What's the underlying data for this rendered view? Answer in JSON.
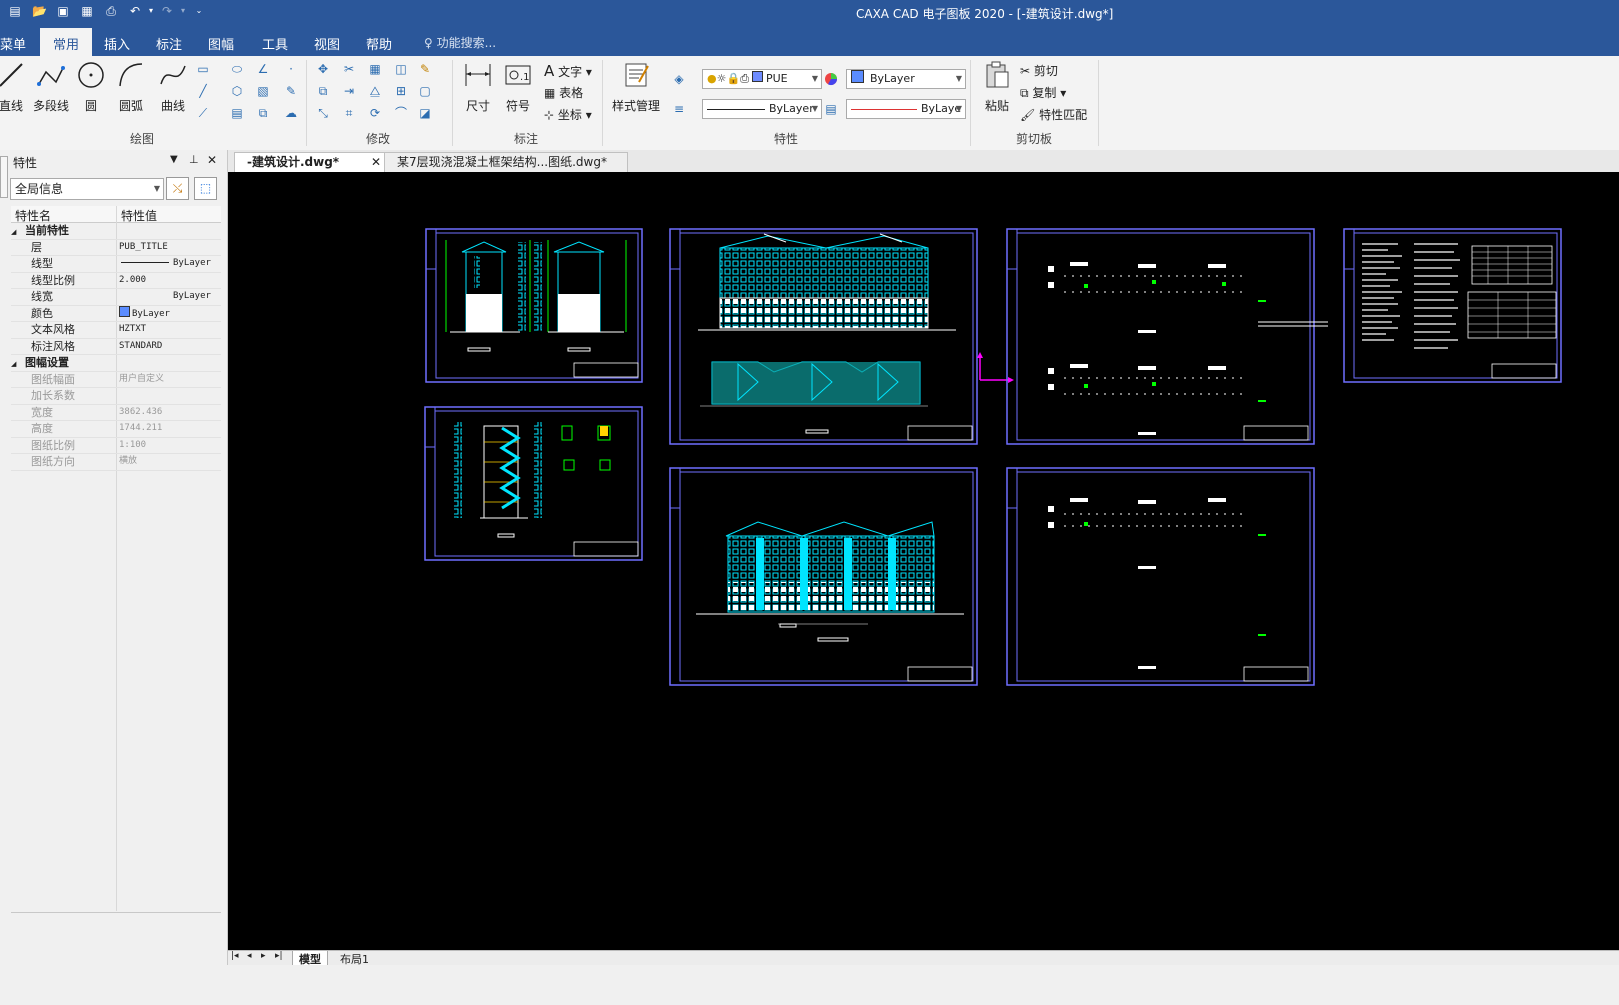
{
  "window": {
    "title": "CAXA CAD 电子图板 2020 - [-建筑设计.dwg*]"
  },
  "ribbon_tabs": [
    "菜单",
    "常用",
    "插入",
    "标注",
    "图幅",
    "工具",
    "视图",
    "帮助"
  ],
  "function_search": "功能搜索...",
  "draw_group": {
    "label": "绘图",
    "buttons": [
      "直线",
      "多段线",
      "圆",
      "圆弧",
      "曲线"
    ]
  },
  "modify_group": {
    "label": "修改"
  },
  "dim_group": {
    "label": "标注",
    "buttons": [
      "尺寸",
      "符号"
    ],
    "small": [
      "文字",
      "表格",
      "坐标"
    ]
  },
  "style_group": {
    "button": "样式管理"
  },
  "prop_group": {
    "label": "特性",
    "layer_value": "PUE",
    "color_value": "ByLayer",
    "linetype_value": "ByLayer",
    "linewidth_value": "ByLaye"
  },
  "clip_group": {
    "label": "剪切板",
    "paste": "粘贴",
    "small": [
      "剪切",
      "复制",
      "特性匹配"
    ]
  },
  "panel": {
    "title": "特性",
    "scope": "全局信息",
    "col_name": "特性名",
    "col_value": "特性值",
    "rows": [
      {
        "k": "当前特性",
        "v": "",
        "type": "group"
      },
      {
        "k": "层",
        "v": "PUB_TITLE",
        "type": "normal"
      },
      {
        "k": "线型",
        "v": "ByLayer",
        "type": "normal"
      },
      {
        "k": "线型比例",
        "v": "2.000",
        "type": "normal"
      },
      {
        "k": "线宽",
        "v": "ByLayer",
        "type": "normal"
      },
      {
        "k": "颜色",
        "v": "ByLayer",
        "type": "normal"
      },
      {
        "k": "文本风格",
        "v": "HZTXT",
        "type": "normal"
      },
      {
        "k": "标注风格",
        "v": "STANDARD",
        "type": "normal"
      },
      {
        "k": "图幅设置",
        "v": "",
        "type": "group"
      },
      {
        "k": "图纸幅面",
        "v": "用户自定义",
        "type": "dim"
      },
      {
        "k": "加长系数",
        "v": "",
        "type": "dim"
      },
      {
        "k": "宽度",
        "v": "3862.436",
        "type": "dim"
      },
      {
        "k": "高度",
        "v": "1744.211",
        "type": "dim"
      },
      {
        "k": "图纸比例",
        "v": "1:100",
        "type": "dim"
      },
      {
        "k": "图纸方向",
        "v": "横放",
        "type": "dim"
      }
    ]
  },
  "doc_tabs": [
    "-建筑设计.dwg*",
    "某7层现浇混凝土框架结构...图纸.dwg*"
  ],
  "layout_tabs": [
    "模型",
    "布局1"
  ],
  "colors": {
    "titlebar": "#2b579a",
    "canvas": "#000000",
    "sheet_frame": "#6f6fff",
    "drawing_cyan": "#00e5ff",
    "drawing_green": "#00ff00",
    "crosshair": "#ff00ff"
  }
}
